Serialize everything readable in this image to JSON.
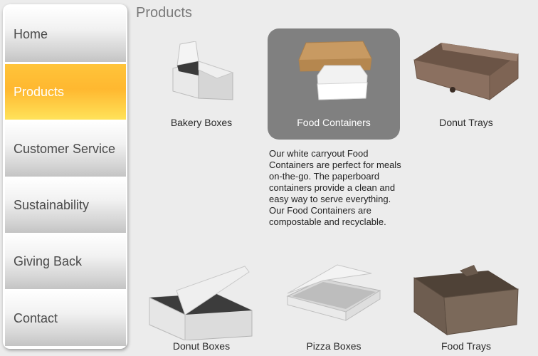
{
  "nav": {
    "items": [
      {
        "label": "Home"
      },
      {
        "label": "Products"
      },
      {
        "label": "Customer Service"
      },
      {
        "label": "Sustainability"
      },
      {
        "label": "Giving Back"
      },
      {
        "label": "Contact"
      }
    ],
    "active": "Products",
    "active_color": "#ffb830"
  },
  "main": {
    "title": "Products",
    "products": [
      {
        "label": "Bakery Boxes"
      },
      {
        "label": "Food Containers"
      },
      {
        "label": "Donut Trays"
      },
      {
        "label": "Donut Boxes"
      },
      {
        "label": "Pizza Boxes"
      },
      {
        "label": "Food Trays"
      }
    ],
    "selected_product": "Food Containers",
    "description": "Our white carryout Food Containers are perfect for meals on-the-go. The paperboard containers provide a clean and easy way to serve everything. Our Food Containers are compostable and recyclable."
  }
}
